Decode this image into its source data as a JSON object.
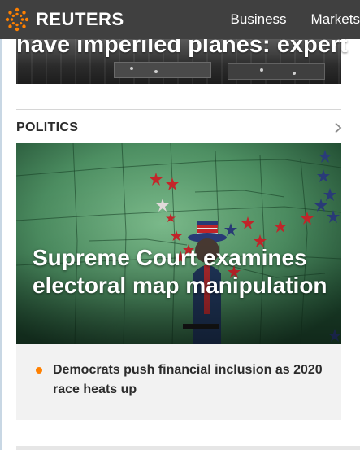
{
  "header": {
    "brand": "REUTERS",
    "brand_color": "#ff8000",
    "background": "#404040",
    "nav": [
      {
        "label": "Business"
      },
      {
        "label": "Markets"
      }
    ]
  },
  "hero": {
    "title": "have imperiled planes: expert"
  },
  "section": {
    "title": "POLITICS",
    "chevron_icon": "chevron-right-icon"
  },
  "feature": {
    "headline": "Supreme Court examines electoral map manipulation"
  },
  "related": [
    {
      "text": "Democrats push financial inclusion as 2020 race heats up"
    }
  ],
  "colors": {
    "bullet": "#ff8000",
    "list_bg": "#f2f2f2",
    "text": "#2b2b2b"
  }
}
